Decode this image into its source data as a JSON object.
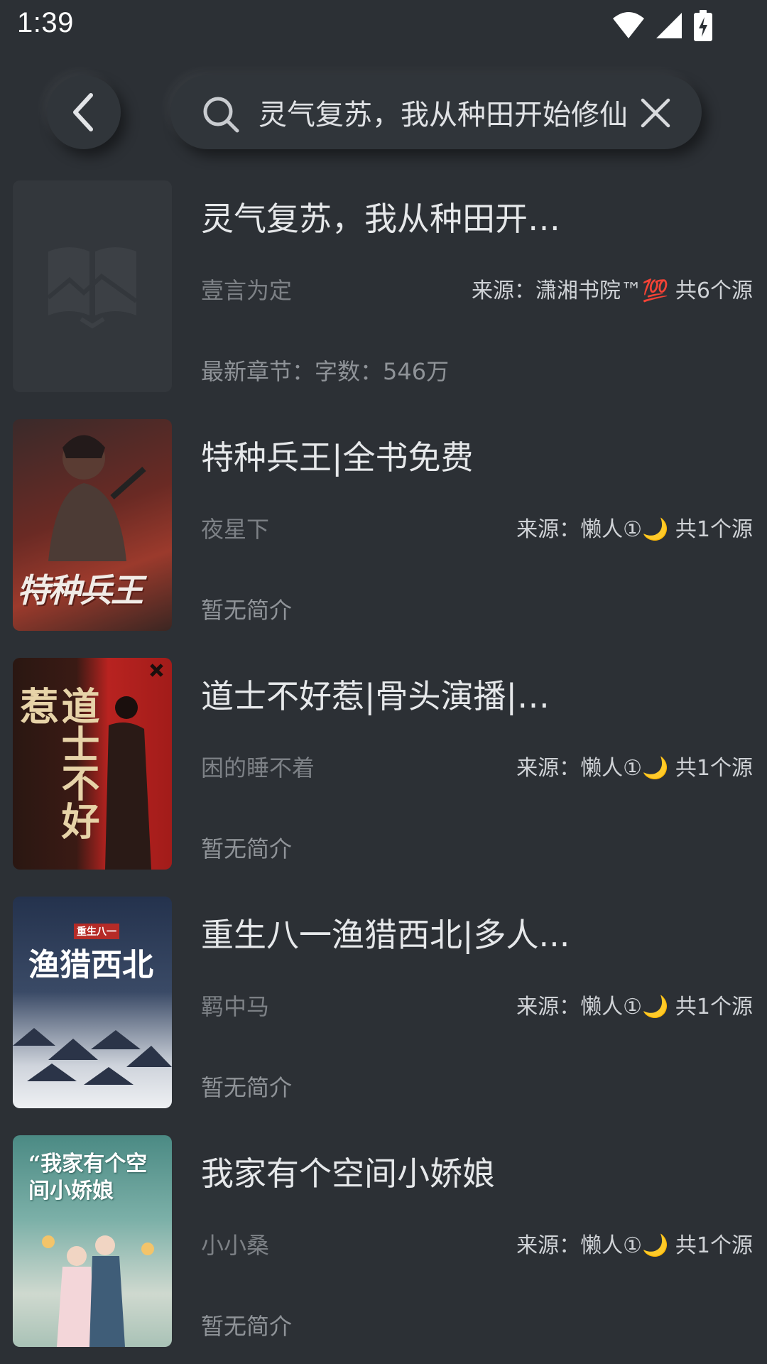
{
  "status_bar": {
    "time": "1:39"
  },
  "search": {
    "query": "灵气复苏，我从种田开始修仙"
  },
  "books": [
    {
      "title": "灵气复苏，我从种田开始...",
      "author": "壹言为定",
      "source": "来源：潇湘书院™💯 共6个源",
      "intro": "最新章节：字数：546万",
      "cover": "placeholder-book-icon"
    },
    {
      "title": "特种兵王|全书免费",
      "author": "夜星下",
      "source": "来源：懒人①︎🌙 共1个源",
      "intro": "暂无简介",
      "cover_text": "特种兵王"
    },
    {
      "title": "道士不好惹|骨头演播|多...",
      "author": "困的睡不着",
      "source": "来源：懒人①︎🌙 共1个源",
      "intro": "暂无简介",
      "cover_text": "道士不好惹"
    },
    {
      "title": "重生八一渔猎西北|多人...",
      "author": "羁中马",
      "source": "来源：懒人①︎🌙 共1个源",
      "intro": "暂无简介",
      "cover_text": "渔猎西北",
      "cover_sub": "重生八一"
    },
    {
      "title": "我家有个空间小娇娘",
      "author": "小小桑",
      "source": "来源：懒人①︎🌙 共1个源",
      "intro": "暂无简介",
      "cover_text": "“我家有个空间小娇娘"
    }
  ]
}
